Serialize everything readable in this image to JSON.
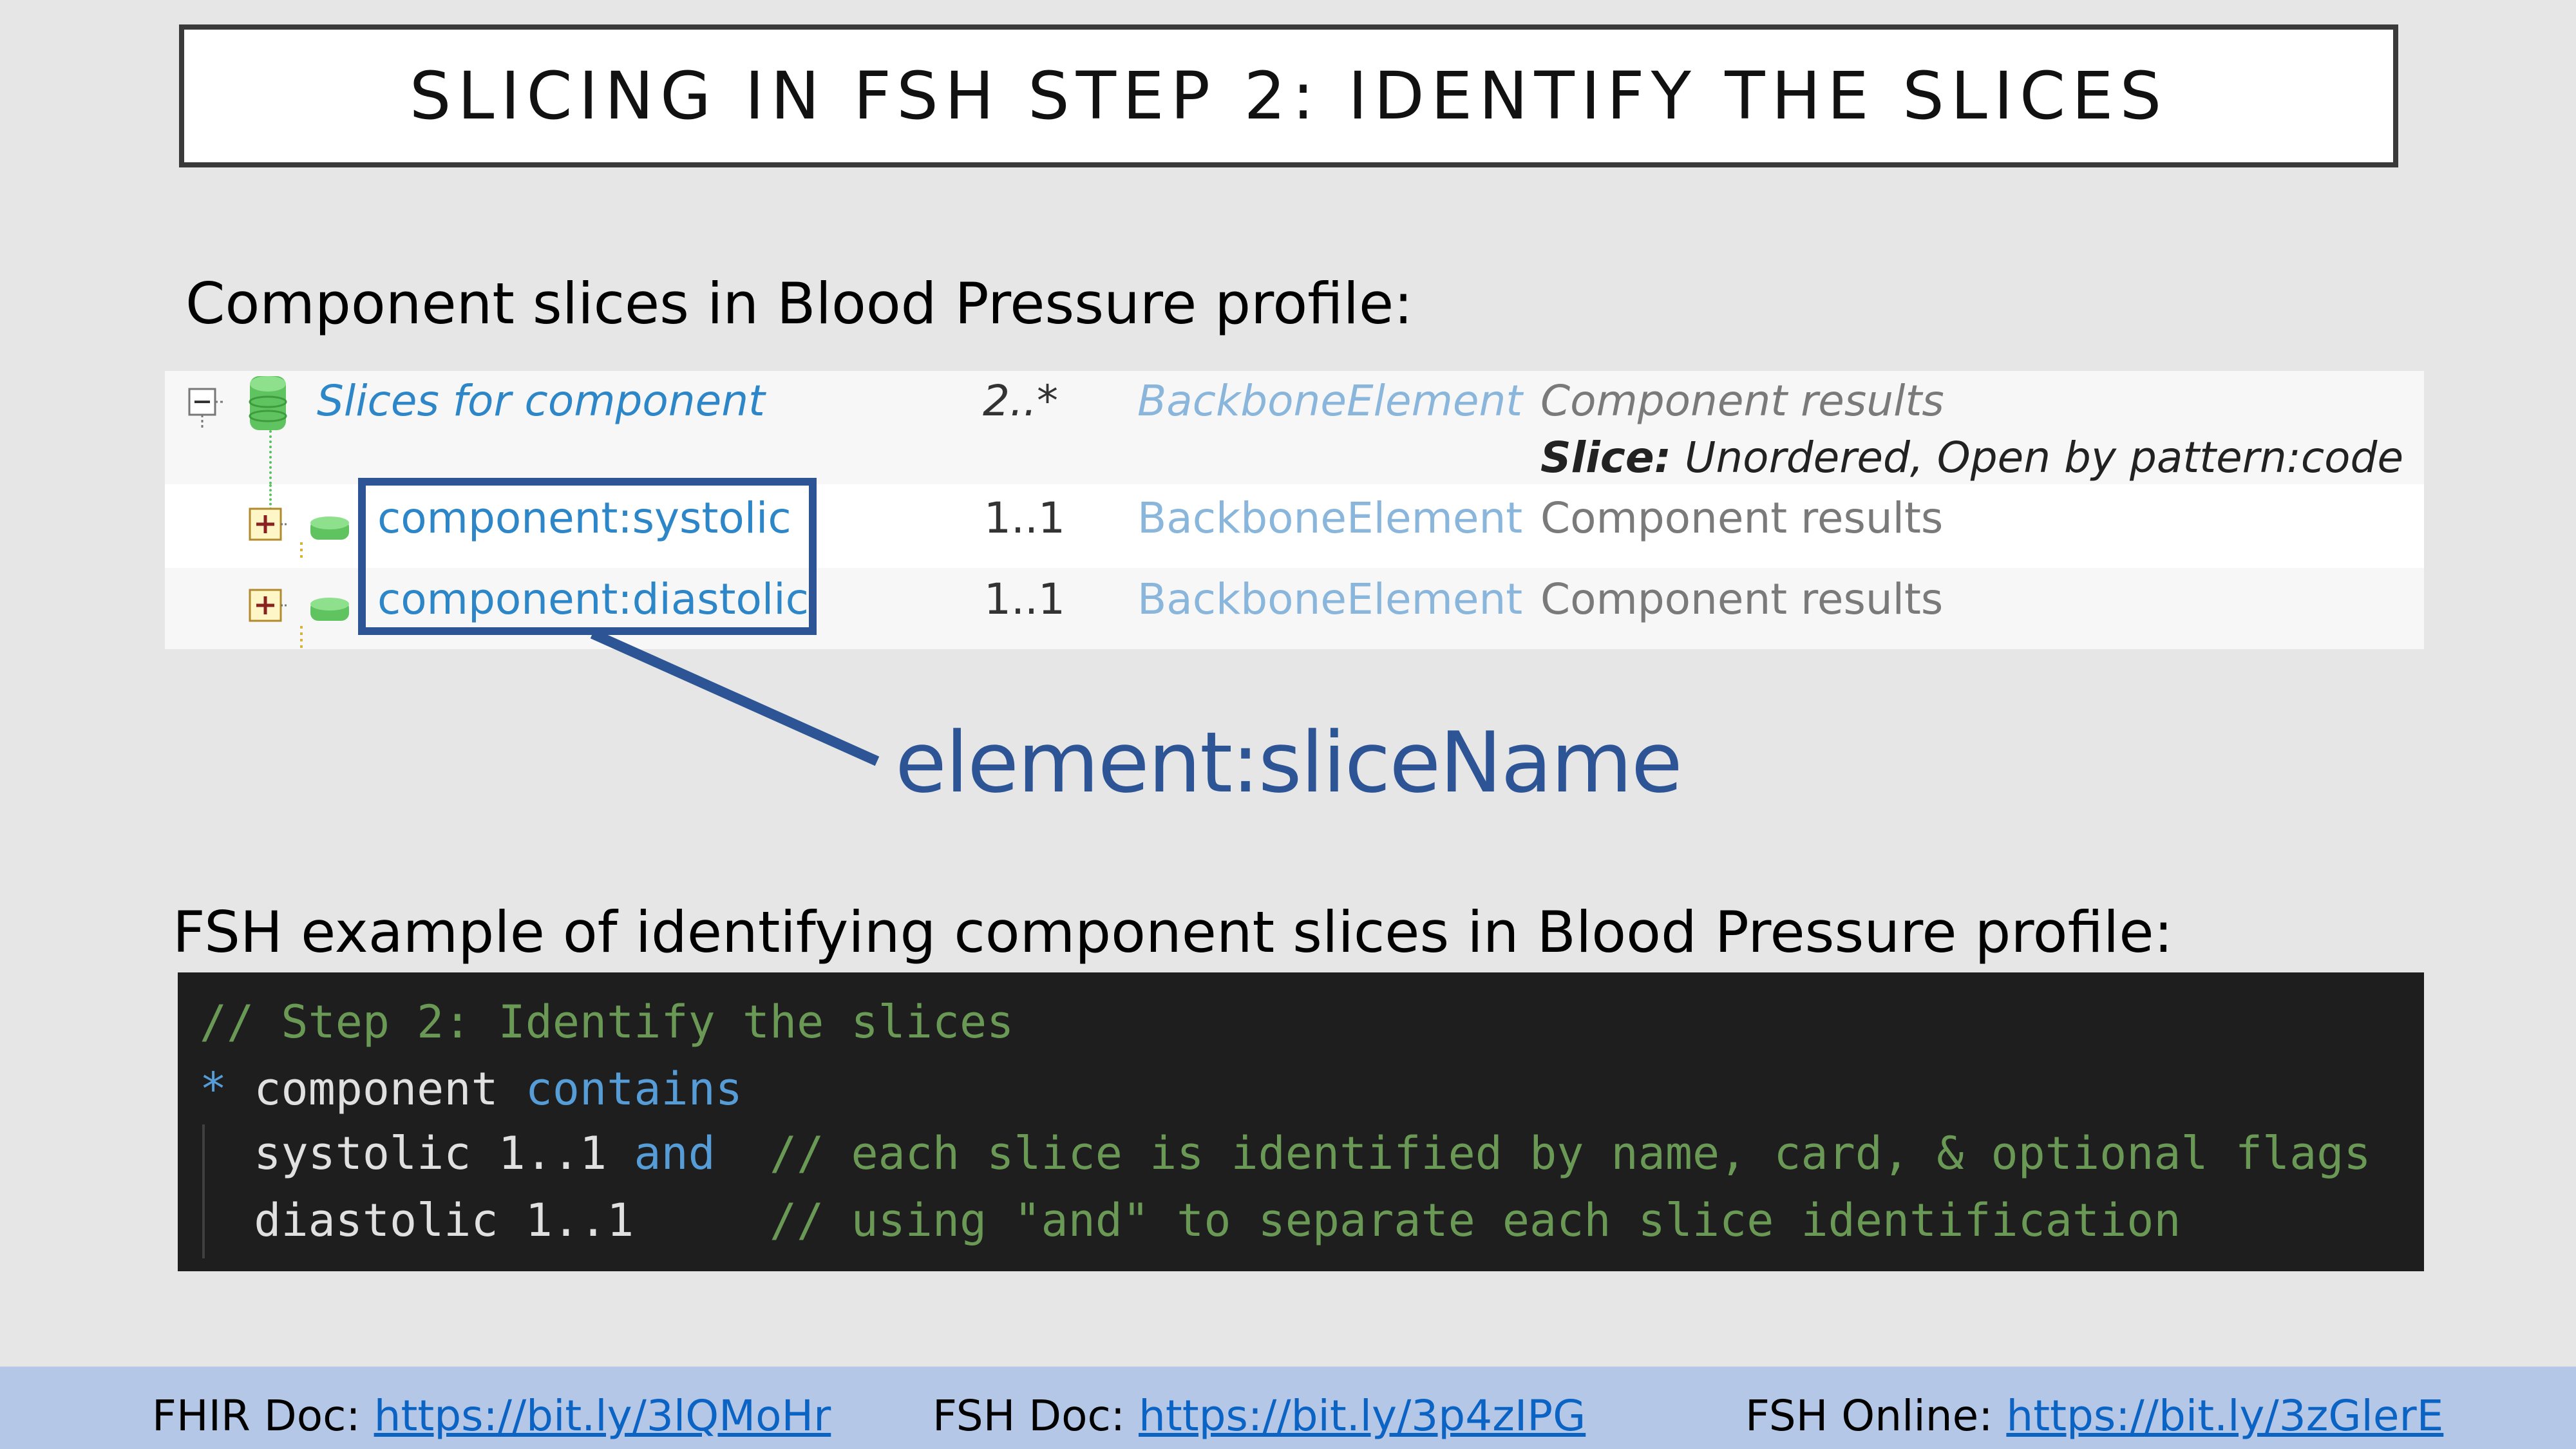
{
  "slide": {
    "title": "SLICING IN FSH STEP 2: IDENTIFY THE SLICES",
    "heading1": "Component slices in Blood Pressure profile:",
    "heading2": "FSH example of identifying component slices in Blood Pressure profile:",
    "callout": "element:sliceName",
    "colors": {
      "accent": "#2d5596",
      "footer": "#b4c7e7",
      "code_bg": "#1e1e1e"
    }
  },
  "table": {
    "rows": [
      {
        "name": "Slices for component",
        "card": "2..*",
        "type": "BackboneElement",
        "desc": "Component results",
        "slice_label": "Slice:",
        "slice_text": "Unordered, Open by pattern:code",
        "icon": "collapse-icon"
      },
      {
        "name": "component:systolic",
        "card": "1..1",
        "type": "BackboneElement",
        "desc": "Component results",
        "icon": "expand-icon"
      },
      {
        "name": "component:diastolic",
        "card": "1..1",
        "type": "BackboneElement",
        "desc": "Component results",
        "icon": "expand-icon"
      }
    ]
  },
  "code": {
    "line1": "// Step 2: Identify the slices",
    "line2_star": "*",
    "line2_word": "component",
    "line2_kw": "contains",
    "line3_code": "systolic 1..1",
    "line3_kw": "and",
    "line3_comment": "// each slice is identified by name, card, & optional flags",
    "line4_code": "diastolic 1..1",
    "line4_comment": "// using \"and\" to separate each slice identification"
  },
  "footer": {
    "items": [
      {
        "label": "FHIR Doc:",
        "link": "https://bit.ly/3lQMoHr"
      },
      {
        "label": "FSH Doc:",
        "link": "https://bit.ly/3p4zIPG"
      },
      {
        "label": "FSH Online:",
        "link": "https://bit.ly/3zGlerE"
      }
    ]
  }
}
